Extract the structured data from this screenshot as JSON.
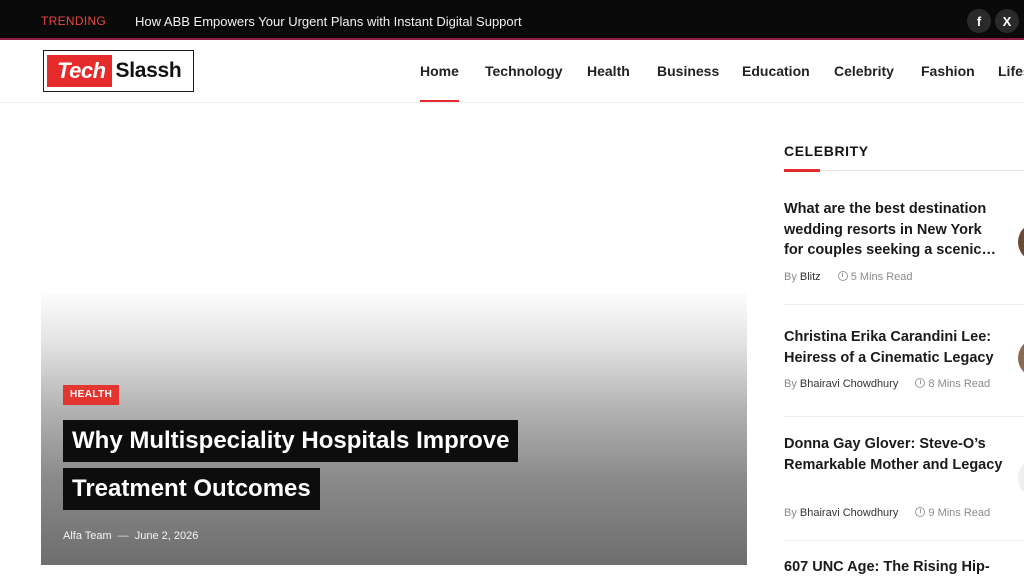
{
  "topbar": {
    "trending_label": "TRENDING",
    "trending_title": "How ABB Empowers Your Urgent Plans with Instant Digital Support",
    "social": [
      {
        "icon": "facebook-icon",
        "glyph": "f"
      },
      {
        "icon": "x-icon",
        "glyph": "X"
      }
    ]
  },
  "logo": {
    "part1": "Tech",
    "part2": "Slassh"
  },
  "nav": {
    "active": "Home",
    "items": [
      "Home",
      "Technology",
      "Health",
      "Business",
      "Education",
      "Celebrity",
      "Fashion",
      "Lifes"
    ]
  },
  "hero": {
    "category": "HEALTH",
    "title_line1": "Why Multispeciality Hospitals Improve",
    "title_line2": "Treatment Outcomes",
    "author": "Alfa Team",
    "separator": "—",
    "date": "June 2, 2026"
  },
  "sidebar": {
    "title": "CELEBRITY",
    "posts": [
      {
        "title": "What are the best destination wedding resorts in New York for couples seeking a scenic…",
        "by": "By",
        "author": "Blitz",
        "read_time": "5 Mins Read"
      },
      {
        "title": "Christina Erika Carandini Lee: Heiress of a Cinematic Legacy",
        "by": "By",
        "author": "Bhairavi Chowdhury",
        "read_time": "8 Mins Read"
      },
      {
        "title": "Donna Gay Glover: Steve-O’s Remarkable Mother and Legacy",
        "by": "By",
        "author": "Bhairavi Chowdhury",
        "read_time": "9 Mins Read"
      },
      {
        "title": "607 UNC Age: The Rising Hip-",
        "by": "",
        "author": "",
        "read_time": ""
      }
    ]
  },
  "colors": {
    "accent": "#e52b2b",
    "topbar_bg": "#0a0a0a"
  }
}
